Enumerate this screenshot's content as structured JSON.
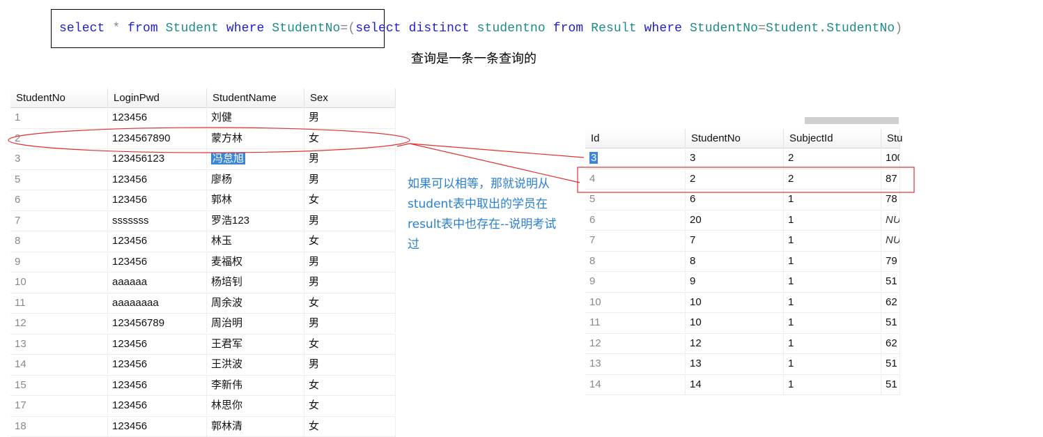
{
  "sql": {
    "tokens": [
      {
        "t": "select",
        "c": "kw"
      },
      {
        "t": " * ",
        "c": "op"
      },
      {
        "t": "from",
        "c": "kw"
      },
      {
        "t": " Student ",
        "c": "id"
      },
      {
        "t": "where",
        "c": "kw"
      },
      {
        "t": " StudentNo",
        "c": "id"
      },
      {
        "t": "=",
        "c": "op"
      },
      {
        "t": "(",
        "c": "op"
      },
      {
        "t": "select",
        "c": "kw"
      },
      {
        "t": " ",
        "c": "op"
      },
      {
        "t": "distinct",
        "c": "kw"
      },
      {
        "t": " studentno ",
        "c": "id"
      },
      {
        "t": "from",
        "c": "kw"
      },
      {
        "t": " Result ",
        "c": "id"
      },
      {
        "t": "where",
        "c": "kw"
      },
      {
        "t": " StudentNo",
        "c": "id"
      },
      {
        "t": "=",
        "c": "op"
      },
      {
        "t": "Student.StudentNo",
        "c": "id"
      },
      {
        "t": ")",
        "c": "op"
      }
    ]
  },
  "caption": "查询是一条一条查询的",
  "note": "如果可以相等，那就说明从student表中取出的学员在result表中也存在--说明考试过",
  "student_table": {
    "columns": [
      "StudentNo",
      "LoginPwd",
      "StudentName",
      "Sex"
    ],
    "rows": [
      [
        "1",
        "123456",
        "刘健",
        "男"
      ],
      [
        "2",
        "1234567890",
        "蒙方林",
        "女"
      ],
      [
        "3",
        "123456123",
        "冯怠旭",
        "男"
      ],
      [
        "5",
        "123456",
        "廖杨",
        "男"
      ],
      [
        "6",
        "123456",
        "郭林",
        "女"
      ],
      [
        "7",
        "sssssss",
        "罗浩123",
        "男"
      ],
      [
        "8",
        "123456",
        "林玉",
        "女"
      ],
      [
        "9",
        "123456",
        "麦福权",
        "男"
      ],
      [
        "10",
        "aaaaaa",
        "杨培钊",
        "男"
      ],
      [
        "11",
        "aaaaaaaa",
        "周余波",
        "女"
      ],
      [
        "12",
        "123456789",
        "周治明",
        "男"
      ],
      [
        "13",
        "123456",
        "王君军",
        "女"
      ],
      [
        "14",
        "123456",
        "王洪波",
        "男"
      ],
      [
        "15",
        "123456",
        "李新伟",
        "女"
      ],
      [
        "17",
        "123456",
        "林思你",
        "女"
      ],
      [
        "18",
        "123456",
        "郭林清",
        "女"
      ]
    ]
  },
  "result_table": {
    "columns": [
      "Id",
      "StudentNo",
      "SubjectId",
      "Stu"
    ],
    "rows": [
      [
        "3",
        "3",
        "2",
        "100"
      ],
      [
        "4",
        "2",
        "2",
        "87"
      ],
      [
        "5",
        "6",
        "1",
        "78"
      ],
      [
        "6",
        "20",
        "1",
        "NUL"
      ],
      [
        "7",
        "7",
        "1",
        "NUL"
      ],
      [
        "8",
        "8",
        "1",
        "79"
      ],
      [
        "9",
        "9",
        "1",
        "51"
      ],
      [
        "10",
        "10",
        "1",
        "62"
      ],
      [
        "11",
        "10",
        "1",
        "51"
      ],
      [
        "12",
        "12",
        "1",
        "62"
      ],
      [
        "13",
        "13",
        "1",
        "51"
      ],
      [
        "14",
        "14",
        "1",
        "51"
      ]
    ]
  },
  "colors": {
    "keyword": "#1f1fd0",
    "identifier": "#1f8a8a",
    "annotation": "#e03030",
    "note": "#2a80d0",
    "selection": "#3b86d6"
  }
}
